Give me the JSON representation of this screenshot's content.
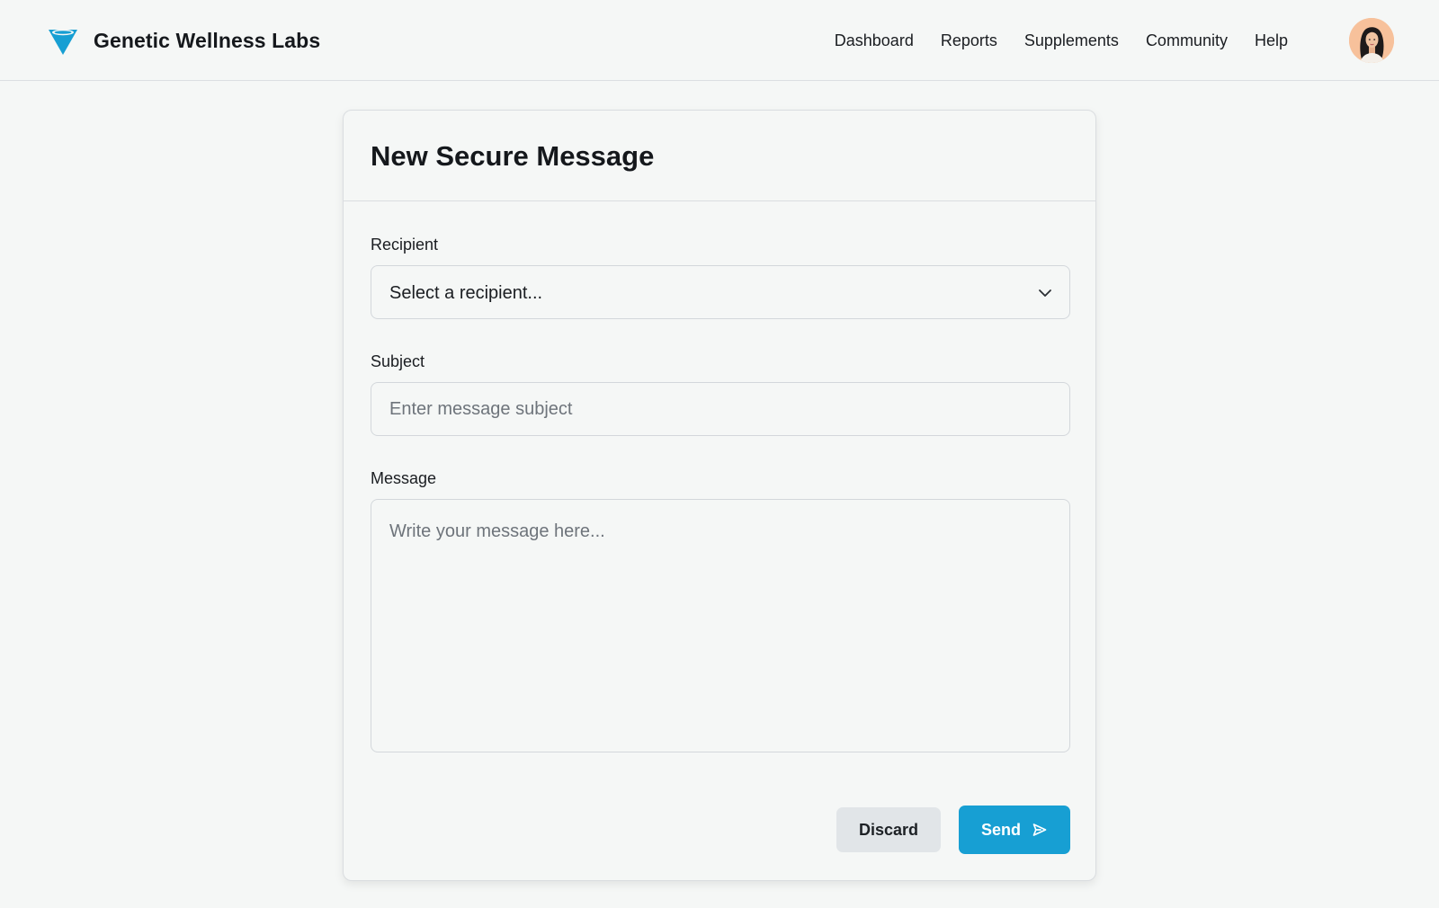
{
  "app": {
    "brand_name": "Genetic Wellness Labs",
    "logo_icon": "funnel-logo-icon",
    "brand_color": "#179fd3"
  },
  "nav": {
    "items": [
      {
        "label": "Dashboard"
      },
      {
        "label": "Reports"
      },
      {
        "label": "Supplements"
      },
      {
        "label": "Community"
      },
      {
        "label": "Help"
      }
    ]
  },
  "user": {
    "avatar_icon": "user-avatar"
  },
  "compose": {
    "title": "New Secure Message",
    "recipient": {
      "label": "Recipient",
      "value": "Select a recipient...",
      "icon": "chevron-down-icon"
    },
    "subject": {
      "label": "Subject",
      "placeholder": "Enter message subject",
      "value": ""
    },
    "message": {
      "label": "Message",
      "placeholder": "Write your message here...",
      "value": ""
    },
    "actions": {
      "discard_label": "Discard",
      "send_label": "Send",
      "send_icon": "send-icon"
    }
  },
  "colors": {
    "accent": "#179fd3",
    "background": "#f5f7f6",
    "secondary_button": "#e1e5e8",
    "avatar_background": "#f7c19b"
  }
}
